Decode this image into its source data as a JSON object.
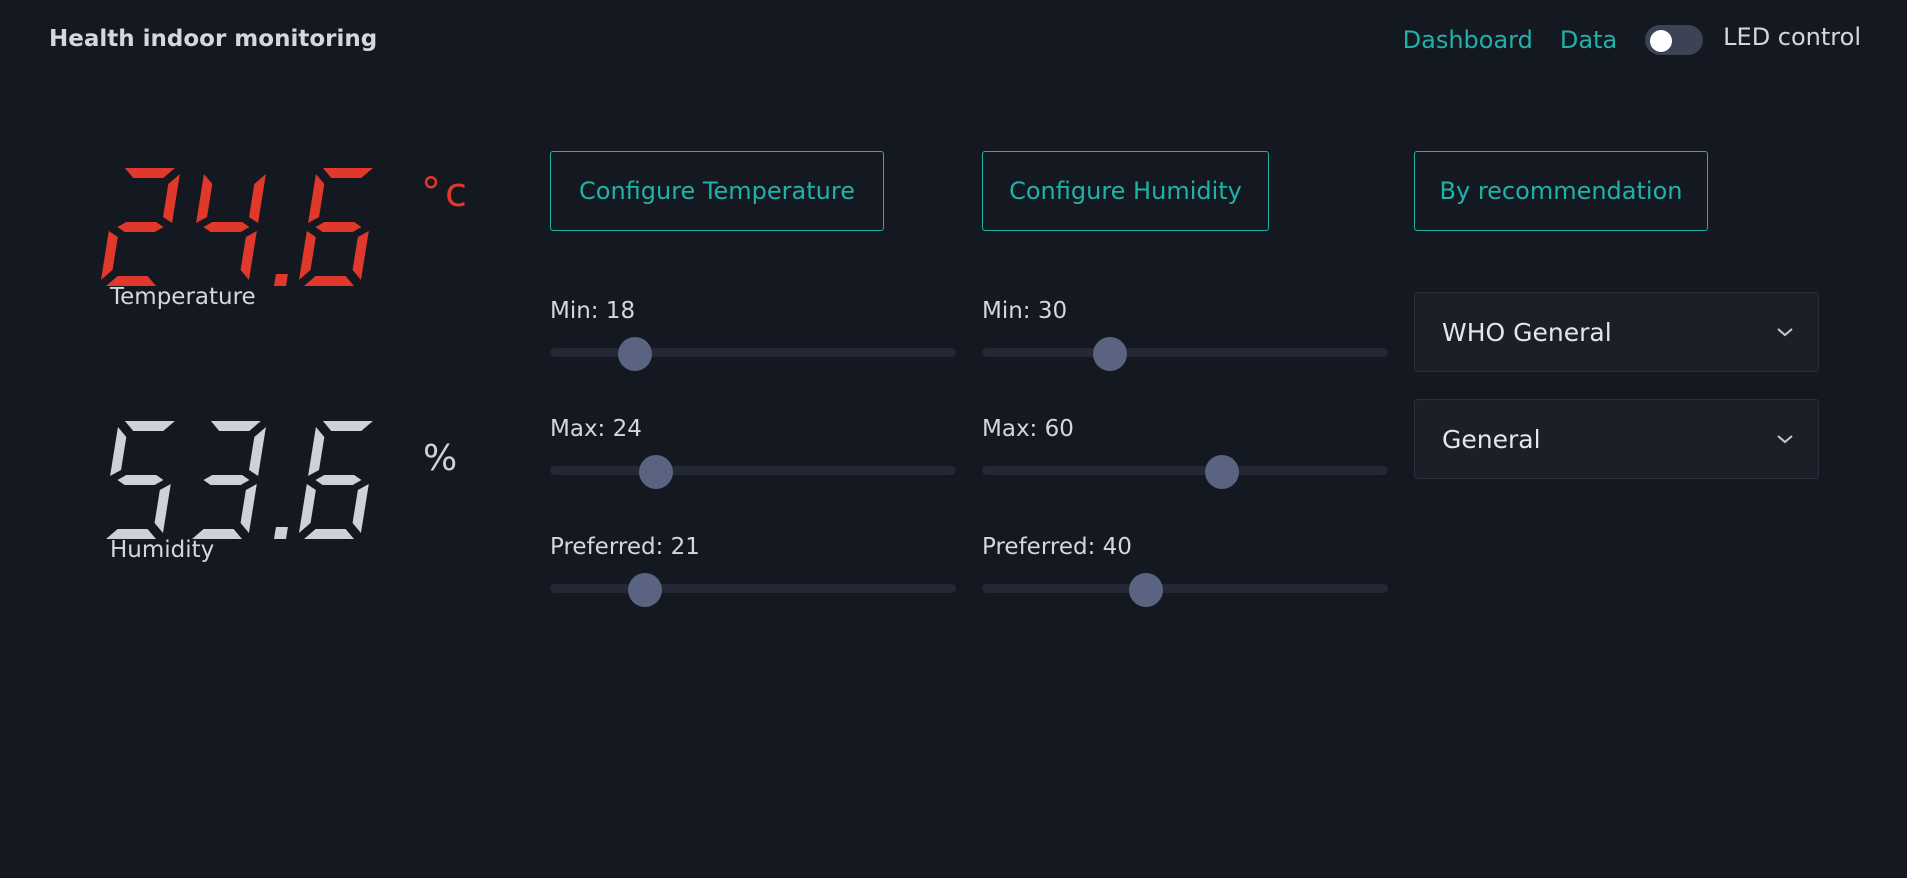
{
  "header": {
    "title": "Health indoor monitoring",
    "nav": [
      {
        "label": "Dashboard"
      },
      {
        "label": "Data"
      }
    ],
    "led_toggle": {
      "on": false,
      "label": "LED control"
    }
  },
  "readings": {
    "temperature": {
      "value": "24.6",
      "unit": "°c",
      "label": "Temperature",
      "color": "#e0382b"
    },
    "humidity": {
      "value": "53.6",
      "unit": "%",
      "label": "Humidity",
      "color": "#cdd1d8"
    }
  },
  "config": {
    "temperature_button": "Configure Temperature",
    "humidity_button": "Configure Humidity",
    "recommendation_button": "By recommendation"
  },
  "sliders": {
    "temperature": [
      {
        "label": "Min: 18",
        "value": 18,
        "fraction": 0.21
      },
      {
        "label": "Max: 24",
        "value": 24,
        "fraction": 0.26
      },
      {
        "label": "Preferred: 21",
        "value": 21,
        "fraction": 0.235
      }
    ],
    "humidity": [
      {
        "label": "Min: 30",
        "value": 30,
        "fraction": 0.315
      },
      {
        "label": "Max: 60",
        "value": 60,
        "fraction": 0.59
      },
      {
        "label": "Preferred: 40",
        "value": 40,
        "fraction": 0.405
      }
    ]
  },
  "recommendation": {
    "source_select": "WHO General",
    "profile_select": "General"
  },
  "colors": {
    "accent": "#20b2aa",
    "background": "#141820",
    "temperature": "#e0382b",
    "humidity": "#cdd1d8",
    "thumb": "#5a6480"
  }
}
